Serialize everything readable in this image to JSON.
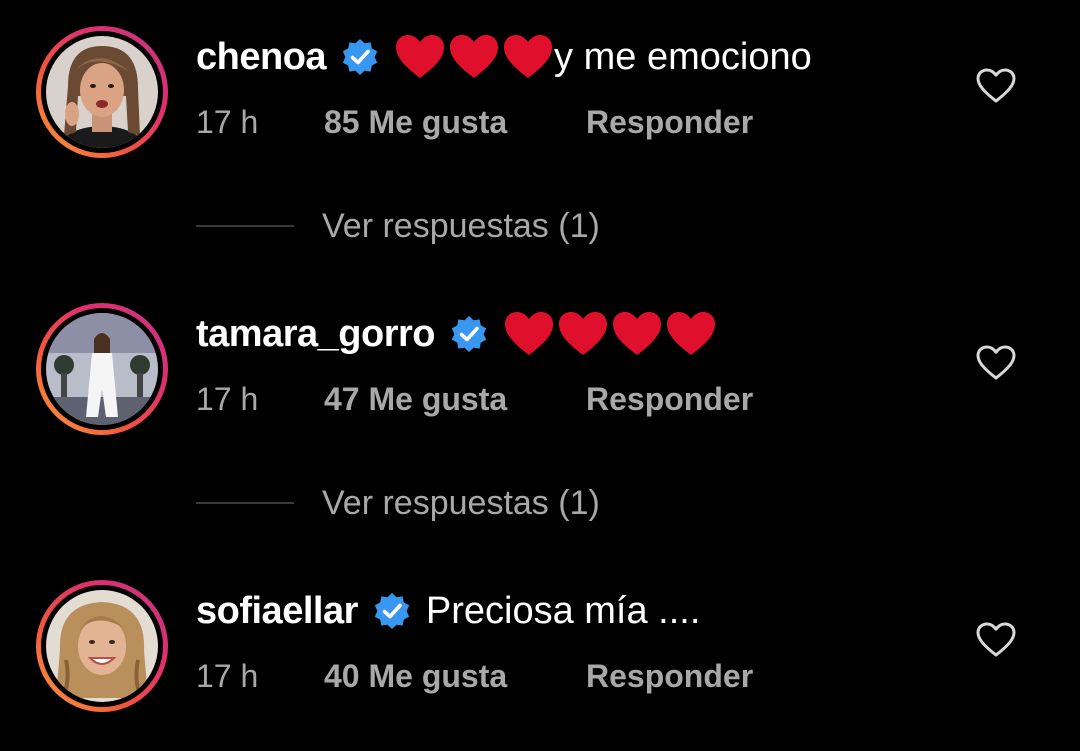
{
  "comments": [
    {
      "username": "chenoa",
      "verified": true,
      "heart_count": 3,
      "text": "y me emociono",
      "time": "17 h",
      "likes": "85 Me gusta",
      "reply_label": "Responder",
      "view_replies": "Ver respuestas (1)"
    },
    {
      "username": "tamara_gorro",
      "verified": true,
      "heart_count": 4,
      "text": "",
      "time": "17 h",
      "likes": "47 Me gusta",
      "reply_label": "Responder",
      "view_replies": "Ver respuestas (1)"
    },
    {
      "username": "sofiaellar",
      "verified": true,
      "heart_count": 0,
      "text": "Preciosa mía ....",
      "time": "17 h",
      "likes": "40 Me gusta",
      "reply_label": "Responder"
    }
  ],
  "icons": {
    "verified": "verified-badge-icon",
    "like": "heart-outline-icon",
    "emoji": "red-heart-emoji"
  },
  "colors": {
    "background": "#000000",
    "primary_text": "#ffffff",
    "secondary_text": "#a8a8a8",
    "verified_blue": "#3897f0",
    "heart_red": "#e0102c",
    "story_ring_start": "#f9a13a",
    "story_ring_end": "#c13584"
  }
}
